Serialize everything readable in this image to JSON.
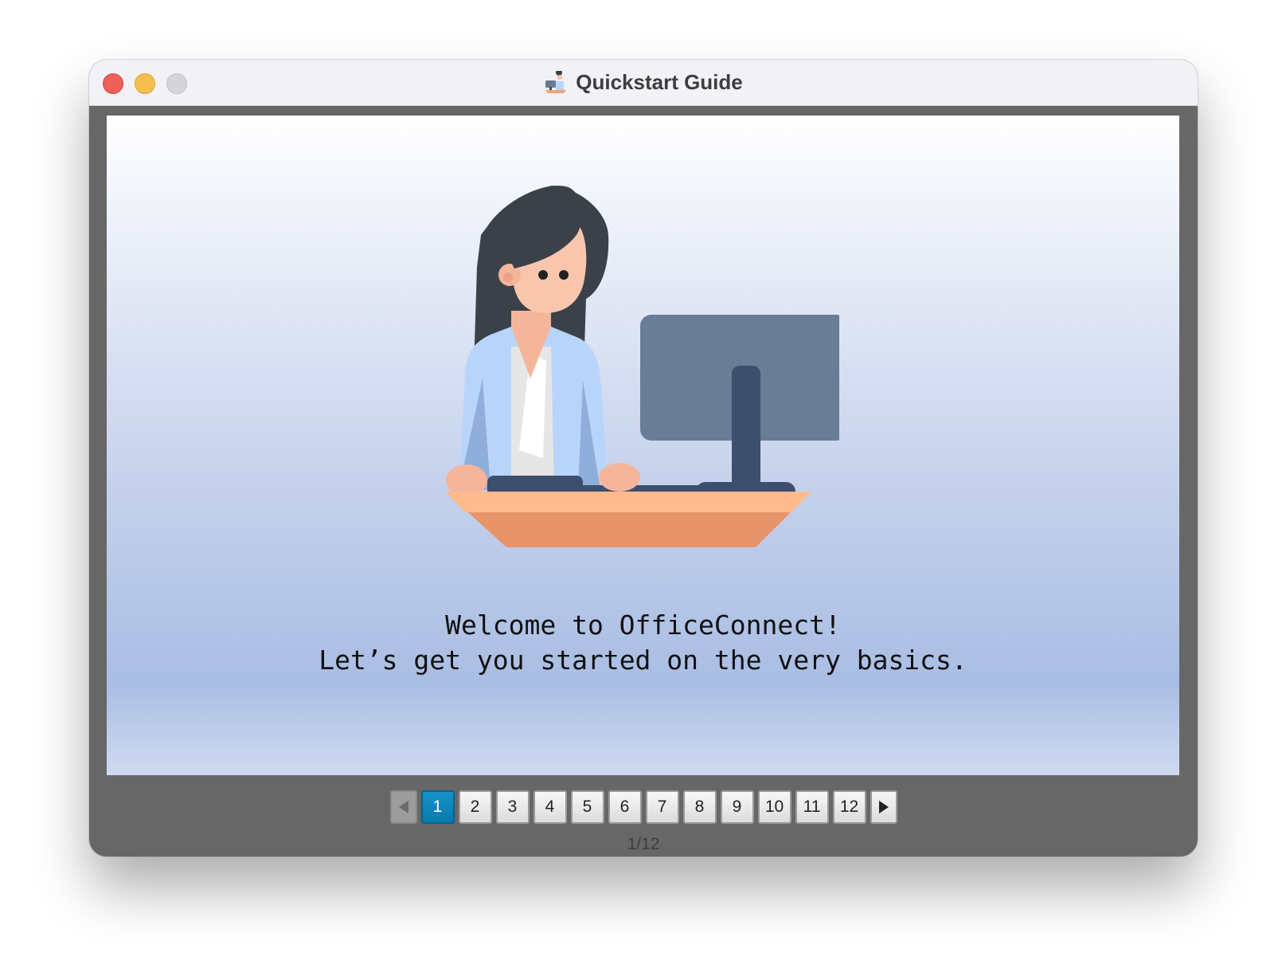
{
  "window": {
    "title": "Quickstart Guide",
    "title_icon": "person-at-computer-icon",
    "traffic_lights": {
      "close": "#ee5f57",
      "minimize": "#f5bf4f",
      "maximize": "#d5d5d8"
    }
  },
  "slide": {
    "illustration": "woman-at-computer-desk",
    "line1": "Welcome to OfficeConnect!",
    "line2": "Let’s get you started on the very basics."
  },
  "pager": {
    "prev_icon": "chevron-left-icon",
    "next_icon": "chevron-right-icon",
    "pages": [
      "1",
      "2",
      "3",
      "4",
      "5",
      "6",
      "7",
      "8",
      "9",
      "10",
      "11",
      "12"
    ],
    "current_page": 1,
    "counter": "1/12",
    "active_color": "#0b84bb"
  }
}
